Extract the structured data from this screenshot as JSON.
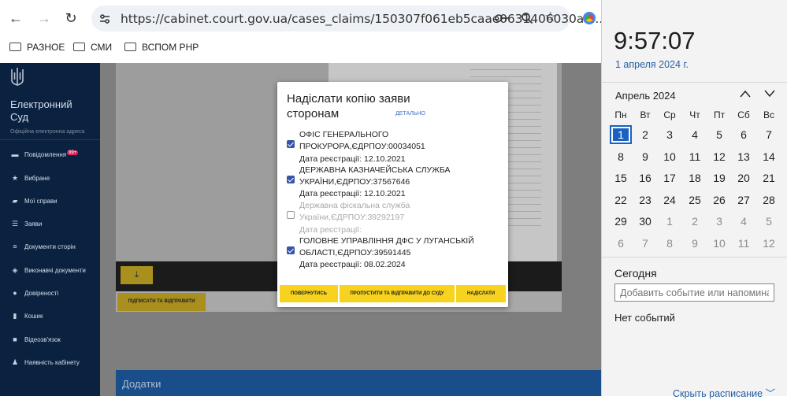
{
  "browser": {
    "url": "https://cabinet.court.gov.ua/cases_claims/150307f061eb5caae0631406030aa...",
    "bookmarks": [
      "РАЗНОЕ",
      "СМИ",
      "ВСПОМ РНР"
    ]
  },
  "sidebar": {
    "title": "Електронний Суд",
    "subtitle": "Офіційна електронна адреса",
    "items": [
      {
        "label": "Повідомлення",
        "icon": "message-icon",
        "badge": "99+"
      },
      {
        "label": "Вибране",
        "icon": "star-icon"
      },
      {
        "label": "Мої справи",
        "icon": "folder-icon"
      },
      {
        "label": "Заяви",
        "icon": "list-icon"
      },
      {
        "label": "Документи сторін",
        "icon": "document-list-icon"
      },
      {
        "label": "Виконавчі документи",
        "icon": "layers-icon"
      },
      {
        "label": "Довіреності",
        "icon": "users-icon"
      },
      {
        "label": "Кошик",
        "icon": "trash-icon"
      },
      {
        "label": "Відеозв'язок",
        "icon": "video-icon"
      },
      {
        "label": "Наявність кабінету",
        "icon": "person-icon"
      }
    ]
  },
  "background": {
    "sign_button": "ПІДПИСАТИ ТА ВІДПРАВИТИ",
    "attachments_title": "Додатки"
  },
  "modal": {
    "title": "Надіслати копію заяви сторонам",
    "details_link": "ДЕТАЛЬНО",
    "parties": [
      {
        "name": "ОФІС ГЕНЕРАЛЬНОГО ПРОКУРОРА,ЄДРПОУ:00034051",
        "date": "Дата реєстрації: 12.10.2021",
        "checked": true
      },
      {
        "name": "ДЕРЖАВНА КАЗНАЧЕЙСЬКА СЛУЖБА УКРАЇНИ,ЄДРПОУ:37567646",
        "date": "Дата реєстрації: 12.10.2021",
        "checked": true
      },
      {
        "name": "Державна фіскальна служба України,ЄДРПОУ:39292197",
        "date": "Дата реєстрації:",
        "checked": false
      },
      {
        "name": "ГОЛОВНЕ УПРАВЛІННЯ ДФС У ЛУГАНСЬКІЙ ОБЛАСТІ,ЄДРПОУ:39591445",
        "date": "Дата реєстрації: 08.02.2024",
        "checked": true
      }
    ],
    "buttons": {
      "back": "ПОВЕРНУТИСЬ",
      "skip": "ПРОПУСТИТИ ТА ВІДПРАВИТИ ДО СУДУ",
      "send": "НАДІСЛАТИ"
    }
  },
  "calendar": {
    "time": "9:57:07",
    "date": "1 апреля 2024 г.",
    "month": "Апрель 2024",
    "weekdays": [
      "Пн",
      "Вт",
      "Ср",
      "Чт",
      "Пт",
      "Сб",
      "Вс"
    ],
    "days": [
      [
        "1",
        "2",
        "3",
        "4",
        "5",
        "6",
        "7"
      ],
      [
        "8",
        "9",
        "10",
        "11",
        "12",
        "13",
        "14"
      ],
      [
        "15",
        "16",
        "17",
        "18",
        "19",
        "20",
        "21"
      ],
      [
        "22",
        "23",
        "24",
        "25",
        "26",
        "27",
        "28"
      ],
      [
        "29",
        "30",
        "1",
        "2",
        "3",
        "4",
        "5"
      ],
      [
        "6",
        "7",
        "8",
        "9",
        "10",
        "11",
        "12"
      ]
    ],
    "today_label": "Сегодня",
    "event_placeholder": "Добавить событие или напоминание",
    "no_events": "Нет событий",
    "hide_schedule": "Скрыть расписание"
  }
}
